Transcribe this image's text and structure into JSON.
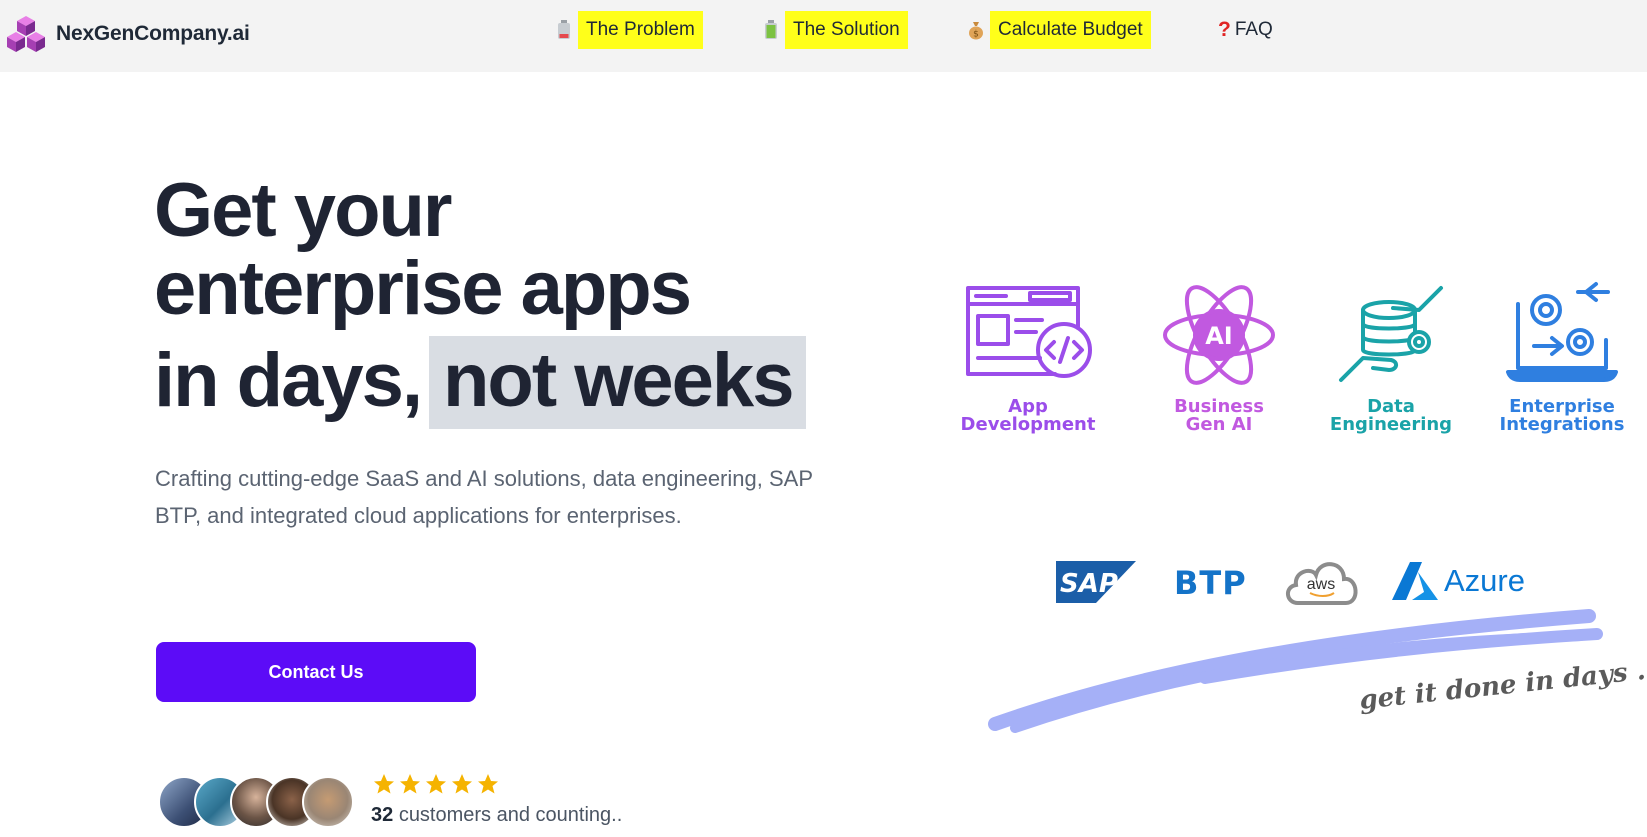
{
  "header": {
    "brand_name": "NexGenCompany.ai",
    "logo_icon": "cubes-icon",
    "nav": [
      {
        "label": "The Problem",
        "icon": "battery-low-icon",
        "highlight": "#ffff1a"
      },
      {
        "label": "The Solution",
        "icon": "battery-full-icon",
        "highlight": "#ffff1a"
      },
      {
        "label": "Calculate Budget",
        "icon": "money-bag-icon",
        "highlight": "#ffff1a"
      },
      {
        "label": "FAQ",
        "icon": "question-mark-icon",
        "highlight": null
      }
    ]
  },
  "hero": {
    "title_line1": "Get your",
    "title_line2": "enterprise apps",
    "title_line3_a": "in days,",
    "title_line3_b": "not weeks",
    "subtitle": "Crafting cutting-edge SaaS and AI solutions, data engineering, SAP BTP, and integrated cloud applications for enterprises.",
    "cta_label": "Contact Us",
    "social_count": "32",
    "social_text": "customers and counting..",
    "rating_stars": 5
  },
  "services": [
    {
      "label": "App\nDevelopment",
      "icon": "code-window-icon",
      "color": "#9b4dea"
    },
    {
      "label": "Business\nGen AI",
      "icon": "ai-atom-icon",
      "color": "#c159e0"
    },
    {
      "label": "Data\nEngineering",
      "icon": "database-hands-icon",
      "color": "#1aa3a8"
    },
    {
      "label": "Enterprise\nIntegrations",
      "icon": "gears-laptop-icon",
      "color": "#2f7fe0"
    }
  ],
  "tech": {
    "sap": "SAP",
    "btp": "BTP",
    "aws": "aws",
    "azure": "Azure"
  },
  "tagline": "get it done in days ...",
  "colors": {
    "accent": "#5c0cf7",
    "header_bg": "#f3f3f3",
    "highlight_yellow": "#ffff1a",
    "star": "#f5b301",
    "stroke": "#a5b0f7"
  }
}
